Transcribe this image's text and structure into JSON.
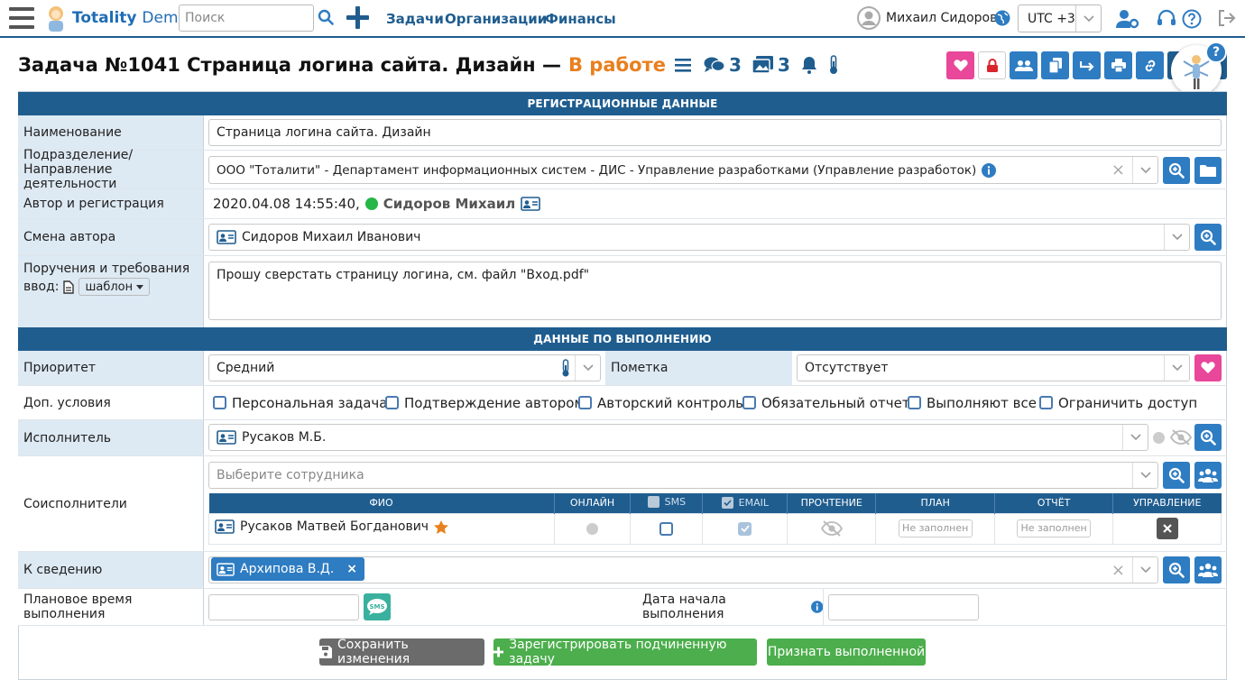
{
  "topbar": {
    "logo": {
      "brand": "Totality",
      "suffix": "Demo"
    },
    "search_placeholder": "Поиск",
    "nav": [
      "Задачи",
      "Организации",
      "Финансы"
    ],
    "user_name": "Михаил Сидоров",
    "timezone": "UTC +3"
  },
  "task": {
    "title": "Задача №1041 Страница логина сайта. Дизайн —",
    "status": "В работе",
    "comments_count": "3",
    "files_count": "3"
  },
  "sections": {
    "registration": "РЕГИСТРАЦИОННЫЕ ДАННЫЕ",
    "execution": "ДАННЫЕ ПО ВЫПОЛНЕНИЮ"
  },
  "reg": {
    "name_label": "Наименование",
    "name_value": "Страница логина сайта. Дизайн",
    "dept_label_1": "Подразделение/",
    "dept_label_2": "Направление деятельности",
    "dept_value": "ООО \"Тоталити\" - Департамент информационных систем - ДИС - Управление разработками (Управление разработок)",
    "author_label": "Автор и регистрация",
    "author_date": "2020.04.08 14:55:40,",
    "author_name": "Сидоров Михаил",
    "change_author_label": "Смена автора",
    "change_author_value": "Сидоров Михаил Иванович",
    "instructions_label_1": "Поручения и требования",
    "instructions_label_2": "ввод:",
    "template_label": "шаблон",
    "instructions_value": "Прошу сверстать страницу логина, см. файл \"Вход.pdf\""
  },
  "exec": {
    "priority_label": "Приоритет",
    "priority_value": "Средний",
    "mark_label": "Пометка",
    "mark_value": "Отсутствует",
    "extra_label": "Доп. условия",
    "options": [
      {
        "label": "Персональная задача",
        "checked": false
      },
      {
        "label": "Подтверждение автором",
        "checked": false
      },
      {
        "label": "Авторский контроль",
        "checked": false
      },
      {
        "label": "Обязательный отчет",
        "checked": false
      },
      {
        "label": "Выполняют все",
        "checked": false
      },
      {
        "label": "Ограничить доступ",
        "checked": false
      }
    ],
    "executor_label": "Исполнитель",
    "executor_value": "Русаков М.Б.",
    "coexec_label": "Соисполнители",
    "coexec_placeholder": "Выберите сотрудника",
    "table_headers": [
      "ФИО",
      "ОНЛАЙН",
      "SMS",
      "EMAIL",
      "ПРОЧТЕНИЕ",
      "ПЛАН",
      "ОТЧЁТ",
      "УПРАВЛЕНИЕ"
    ],
    "coexec_rows": [
      {
        "name": "Русаков Матвей Богданович",
        "sms": false,
        "email": true,
        "plan": "Не заполнен",
        "report": "Не заполнен"
      }
    ],
    "info_label": "К сведению",
    "info_tag": "Архипова В.Д.",
    "plan_time_label": "Плановое время выполнения",
    "start_date_label": "Дата начала выполнения"
  },
  "actions": {
    "save": "Сохранить изменения",
    "register_sub": "Зарегистрировать подчиненную задачу",
    "mark_done": "Признать выполненной"
  },
  "colors": {
    "primary": "#2e7cc2",
    "header": "#1f5d8f",
    "status": "#e8801e",
    "pink": "#e8479a",
    "green": "#4cae4c",
    "grey": "#666666"
  }
}
